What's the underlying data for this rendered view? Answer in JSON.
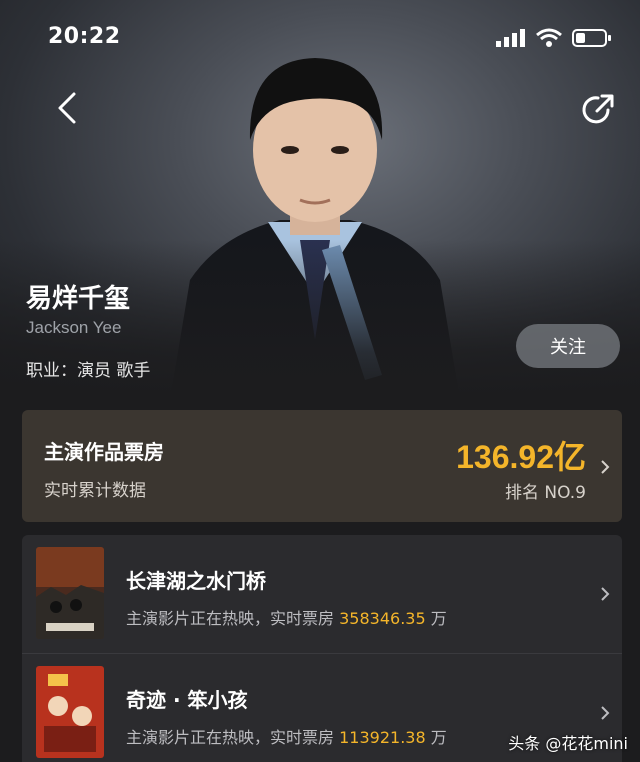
{
  "status_bar": {
    "time": "20:22"
  },
  "actor": {
    "name": "易烊千玺",
    "name_en": "Jackson Yee",
    "profession": "职业：演员 歌手",
    "follow_label": "关注"
  },
  "box_office": {
    "title": "主演作品票房",
    "subtitle": "实时累计数据",
    "value": "136.92亿",
    "rank": "排名 NO.9"
  },
  "films": [
    {
      "title": "长津湖之水门桥",
      "status": "主演影片正在热映，实时票房",
      "gross": "358346.35",
      "unit": "万"
    },
    {
      "title": "奇迹 · 笨小孩",
      "status": "主演影片正在热映，实时票房",
      "gross": "113921.38",
      "unit": "万"
    }
  ],
  "watermark": "头条 @花花mini",
  "colors": {
    "accent": "#f4b52a",
    "card": "#3b3630",
    "list_bg": "#2b2b2e"
  }
}
